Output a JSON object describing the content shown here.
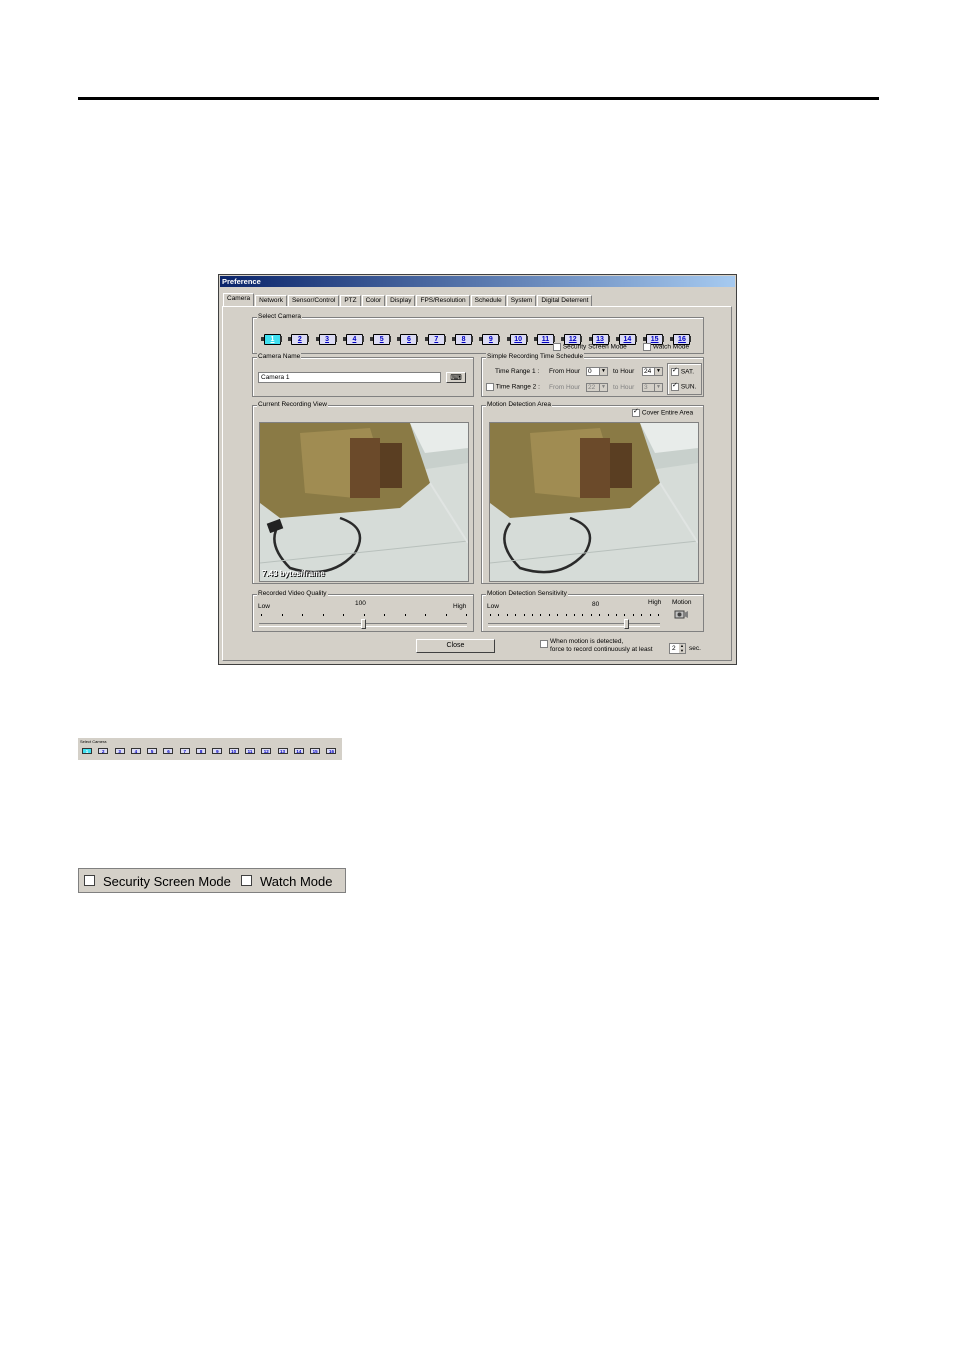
{
  "dialog": {
    "title": "Preference",
    "tabs": [
      "Camera",
      "Network",
      "Sensor/Control",
      "PTZ",
      "Color",
      "Display",
      "FPS/Resolution",
      "Schedule",
      "System",
      "Digital Deterrent"
    ],
    "active_tab": "Camera",
    "select_camera": {
      "label": "Select Camera",
      "cameras": [
        "1",
        "2",
        "3",
        "4",
        "5",
        "6",
        "7",
        "8",
        "9",
        "10",
        "11",
        "12",
        "13",
        "14",
        "15",
        "16"
      ],
      "selected": "1",
      "security_screen_mode": "Security Screen Mode",
      "watch_mode": "Watch Mode"
    },
    "camera_name": {
      "label": "Camera Name",
      "value": "Camera 1"
    },
    "schedule": {
      "label": "Simple Recording Time Schedule",
      "range1_label": "Time Range 1 :",
      "range1_from_label": "From Hour",
      "range1_from_value": "0",
      "range1_to_label": "to Hour",
      "range1_to_value": "24",
      "range2_label": "Time Range 2 :",
      "range2_from_label": "From Hour",
      "range2_from_value": "22",
      "range2_to_label": "to Hour",
      "range2_to_value": "3",
      "sat_label": "SAT.",
      "sun_label": "SUN."
    },
    "current_view": {
      "label": "Current Recording View",
      "overlay": "7.43 bytes/frame"
    },
    "motion_area": {
      "label": "Motion Detection Area",
      "cover_label": "Cover Entire Area"
    },
    "quality": {
      "label": "Recorded Video Quality",
      "low": "Low",
      "high": "High",
      "value": "100",
      "level": 0.5
    },
    "sensitivity": {
      "label": "Motion Detection Sensitivity",
      "low": "Low",
      "high": "High",
      "value": "80",
      "level": 0.8,
      "motion_label": "Motion"
    },
    "close_label": "Close",
    "force_line1": "When motion is detected,",
    "force_line2": "force to record continuously at least",
    "force_value": "2",
    "force_unit": "sec."
  },
  "mini_select": {
    "label": "Select Camera",
    "cameras": [
      "1",
      "2",
      "3",
      "4",
      "5",
      "6",
      "7",
      "8",
      "9",
      "10",
      "11",
      "12",
      "13",
      "14",
      "15",
      "16"
    ]
  },
  "modes_bar": {
    "security_screen_mode": "Security Screen Mode",
    "watch_mode": "Watch Mode"
  }
}
